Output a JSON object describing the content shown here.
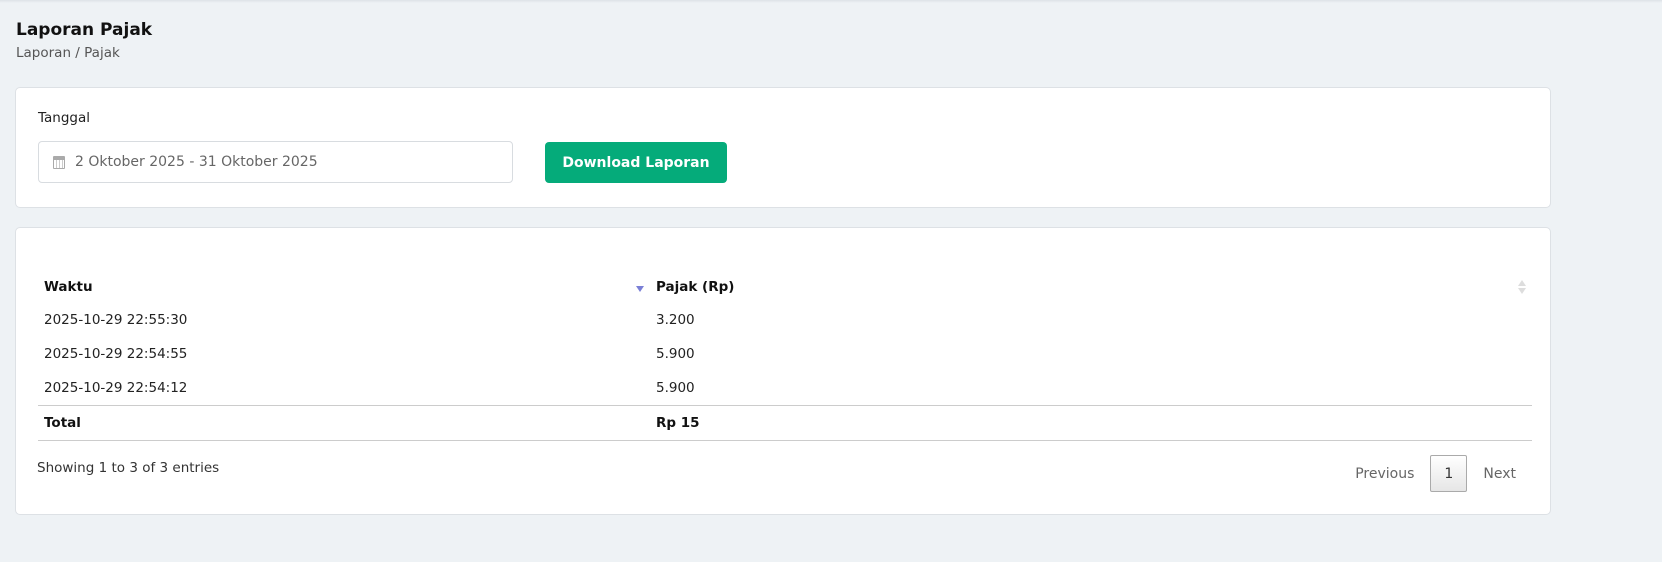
{
  "header": {
    "title": "Laporan Pajak",
    "breadcrumb": "Laporan / Pajak"
  },
  "filter": {
    "label": "Tanggal",
    "date_range": "2 Oktober 2025 - 31 Oktober 2025",
    "download_label": "Download Laporan"
  },
  "table": {
    "columns": [
      "Waktu",
      "Pajak (Rp)"
    ],
    "rows": [
      [
        "2025-10-29 22:55:30",
        "3.200"
      ],
      [
        "2025-10-29 22:54:55",
        "5.900"
      ],
      [
        "2025-10-29 22:54:12",
        "5.900"
      ]
    ],
    "total": [
      "Total",
      "Rp 15"
    ]
  },
  "footer": {
    "info": "Showing 1 to 3 of 3 entries",
    "previous": "Previous",
    "page": "1",
    "next": "Next"
  },
  "colors": {
    "accent": "#05ab7a",
    "sort": "#7a7fd6"
  }
}
